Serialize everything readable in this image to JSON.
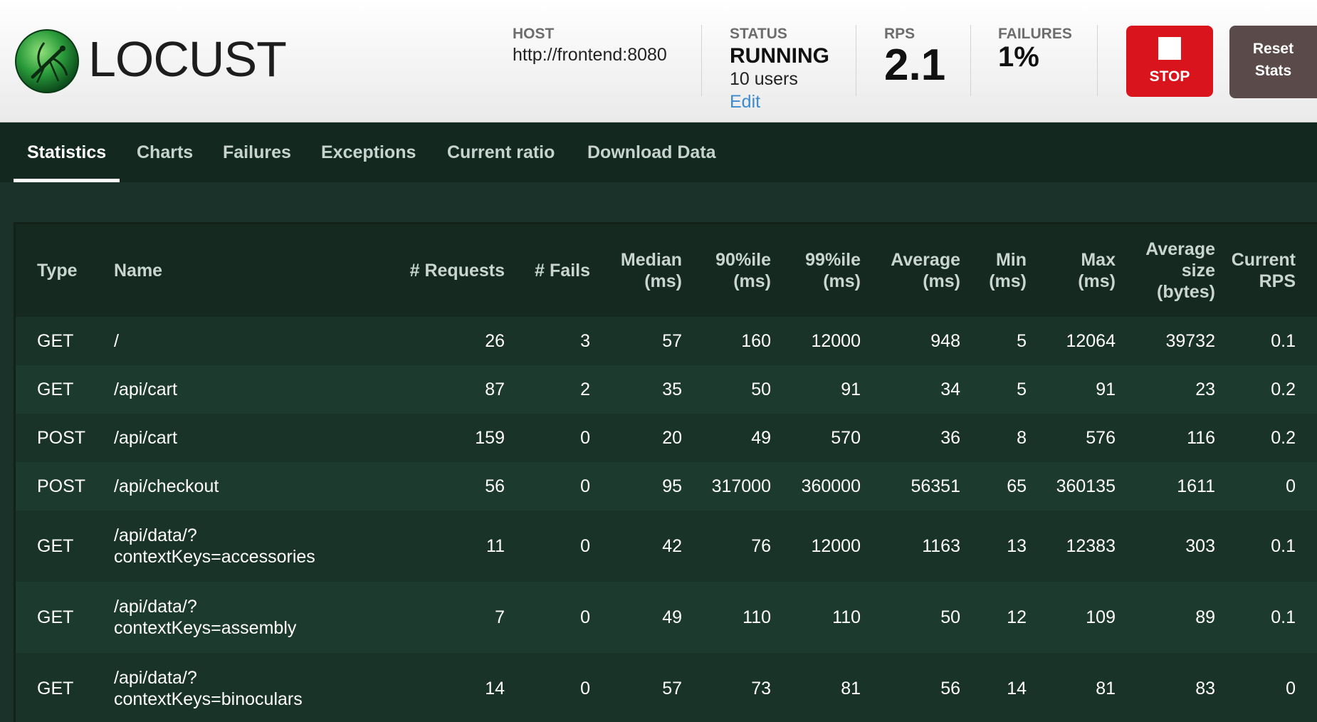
{
  "header": {
    "app_name": "LOCUST",
    "host_label": "HOST",
    "host_value": "http://frontend:8080",
    "status_label": "STATUS",
    "status_value": "RUNNING",
    "users_text": "10 users",
    "edit_link": "Edit",
    "rps_label": "RPS",
    "rps_value": "2.1",
    "failures_label": "FAILURES",
    "failures_value": "1%",
    "stop_label": "STOP",
    "reset_label_line1": "Reset",
    "reset_label_line2": "Stats",
    "colors": {
      "stop_bg": "#d9141c",
      "reset_bg": "#5a4a4a",
      "edit_link": "#3c8ad0"
    }
  },
  "tabs": [
    {
      "label": "Statistics",
      "active": true
    },
    {
      "label": "Charts",
      "active": false
    },
    {
      "label": "Failures",
      "active": false
    },
    {
      "label": "Exceptions",
      "active": false
    },
    {
      "label": "Current ratio",
      "active": false
    },
    {
      "label": "Download Data",
      "active": false
    }
  ],
  "table": {
    "columns": [
      {
        "line1": "Type",
        "line2": "",
        "line3": ""
      },
      {
        "line1": "Name",
        "line2": "",
        "line3": ""
      },
      {
        "line1": "# Requests",
        "line2": "",
        "line3": ""
      },
      {
        "line1": "# Fails",
        "line2": "",
        "line3": ""
      },
      {
        "line1": "Median",
        "line2": "(ms)",
        "line3": ""
      },
      {
        "line1": "90%ile",
        "line2": "(ms)",
        "line3": ""
      },
      {
        "line1": "99%ile",
        "line2": "(ms)",
        "line3": ""
      },
      {
        "line1": "Average",
        "line2": "(ms)",
        "line3": ""
      },
      {
        "line1": "Min",
        "line2": "(ms)",
        "line3": ""
      },
      {
        "line1": "Max",
        "line2": "(ms)",
        "line3": ""
      },
      {
        "line1": "Average",
        "line2": "size",
        "line3": "(bytes)"
      },
      {
        "line1": "Current",
        "line2": "RPS",
        "line3": ""
      }
    ],
    "rows": [
      {
        "type": "GET",
        "name1": "/",
        "name2": "",
        "requests": "26",
        "fails": "3",
        "median": "57",
        "p90": "160",
        "p99": "12000",
        "avg": "948",
        "min": "5",
        "max": "12064",
        "size": "39732",
        "rps": "0.1"
      },
      {
        "type": "GET",
        "name1": "/api/cart",
        "name2": "",
        "requests": "87",
        "fails": "2",
        "median": "35",
        "p90": "50",
        "p99": "91",
        "avg": "34",
        "min": "5",
        "max": "91",
        "size": "23",
        "rps": "0.2"
      },
      {
        "type": "POST",
        "name1": "/api/cart",
        "name2": "",
        "requests": "159",
        "fails": "0",
        "median": "20",
        "p90": "49",
        "p99": "570",
        "avg": "36",
        "min": "8",
        "max": "576",
        "size": "116",
        "rps": "0.2"
      },
      {
        "type": "POST",
        "name1": "/api/checkout",
        "name2": "",
        "requests": "56",
        "fails": "0",
        "median": "95",
        "p90": "317000",
        "p99": "360000",
        "avg": "56351",
        "min": "65",
        "max": "360135",
        "size": "1611",
        "rps": "0"
      },
      {
        "type": "GET",
        "name1": "/api/data/?",
        "name2": "contextKeys=accessories",
        "requests": "11",
        "fails": "0",
        "median": "42",
        "p90": "76",
        "p99": "12000",
        "avg": "1163",
        "min": "13",
        "max": "12383",
        "size": "303",
        "rps": "0.1"
      },
      {
        "type": "GET",
        "name1": "/api/data/?",
        "name2": "contextKeys=assembly",
        "requests": "7",
        "fails": "0",
        "median": "49",
        "p90": "110",
        "p99": "110",
        "avg": "50",
        "min": "12",
        "max": "109",
        "size": "89",
        "rps": "0.1"
      },
      {
        "type": "GET",
        "name1": "/api/data/?",
        "name2": "contextKeys=binoculars",
        "requests": "14",
        "fails": "0",
        "median": "57",
        "p90": "73",
        "p99": "81",
        "avg": "56",
        "min": "14",
        "max": "81",
        "size": "83",
        "rps": "0"
      }
    ]
  }
}
